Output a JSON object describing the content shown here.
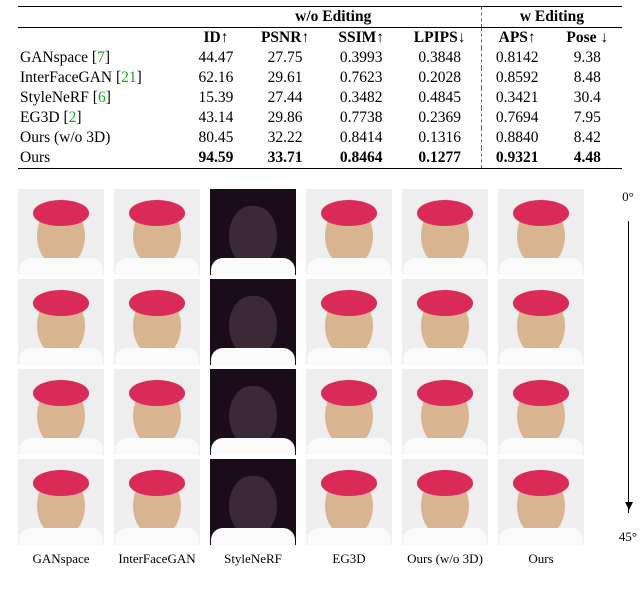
{
  "table": {
    "group1": "w/o Editing",
    "group2": "w Editing",
    "columns": [
      "ID↑",
      "PSNR↑",
      "SSIM↑",
      "LPIPS↓",
      "APS↑",
      "Pose ↓"
    ],
    "rows": [
      {
        "method": "GANspace",
        "cite": "[7]",
        "vals": [
          "44.47",
          "27.75",
          "0.3993",
          "0.3848",
          "0.8142",
          "9.38"
        ],
        "bold": false
      },
      {
        "method": "InterFaceGAN",
        "cite": "[21]",
        "vals": [
          "62.16",
          "29.61",
          "0.7623",
          "0.2028",
          "0.8592",
          "8.48"
        ],
        "bold": false
      },
      {
        "method": "StyleNeRF",
        "cite": "[6]",
        "vals": [
          "15.39",
          "27.44",
          "0.3482",
          "0.4845",
          "0.3421",
          "30.4"
        ],
        "bold": false
      },
      {
        "method": "EG3D",
        "cite": "[2]",
        "vals": [
          "43.14",
          "29.86",
          "0.7738",
          "0.2369",
          "0.7694",
          "7.95"
        ],
        "bold": false
      },
      {
        "method": "Ours (w/o 3D)",
        "cite": "",
        "vals": [
          "80.45",
          "32.22",
          "0.8414",
          "0.1316",
          "0.8840",
          "8.42"
        ],
        "bold": false
      },
      {
        "method": "Ours",
        "cite": "",
        "vals": [
          "94.59",
          "33.71",
          "0.8464",
          "0.1277",
          "0.9321",
          "4.48"
        ],
        "bold": true
      }
    ]
  },
  "figure": {
    "columns": [
      "GANspace",
      "InterFaceGAN",
      "StyleNeRF",
      "EG3D",
      "Ours (w/o 3D)",
      "Ours"
    ],
    "angle_top": "0°",
    "angle_bottom": "45°",
    "row_angles": 4
  }
}
